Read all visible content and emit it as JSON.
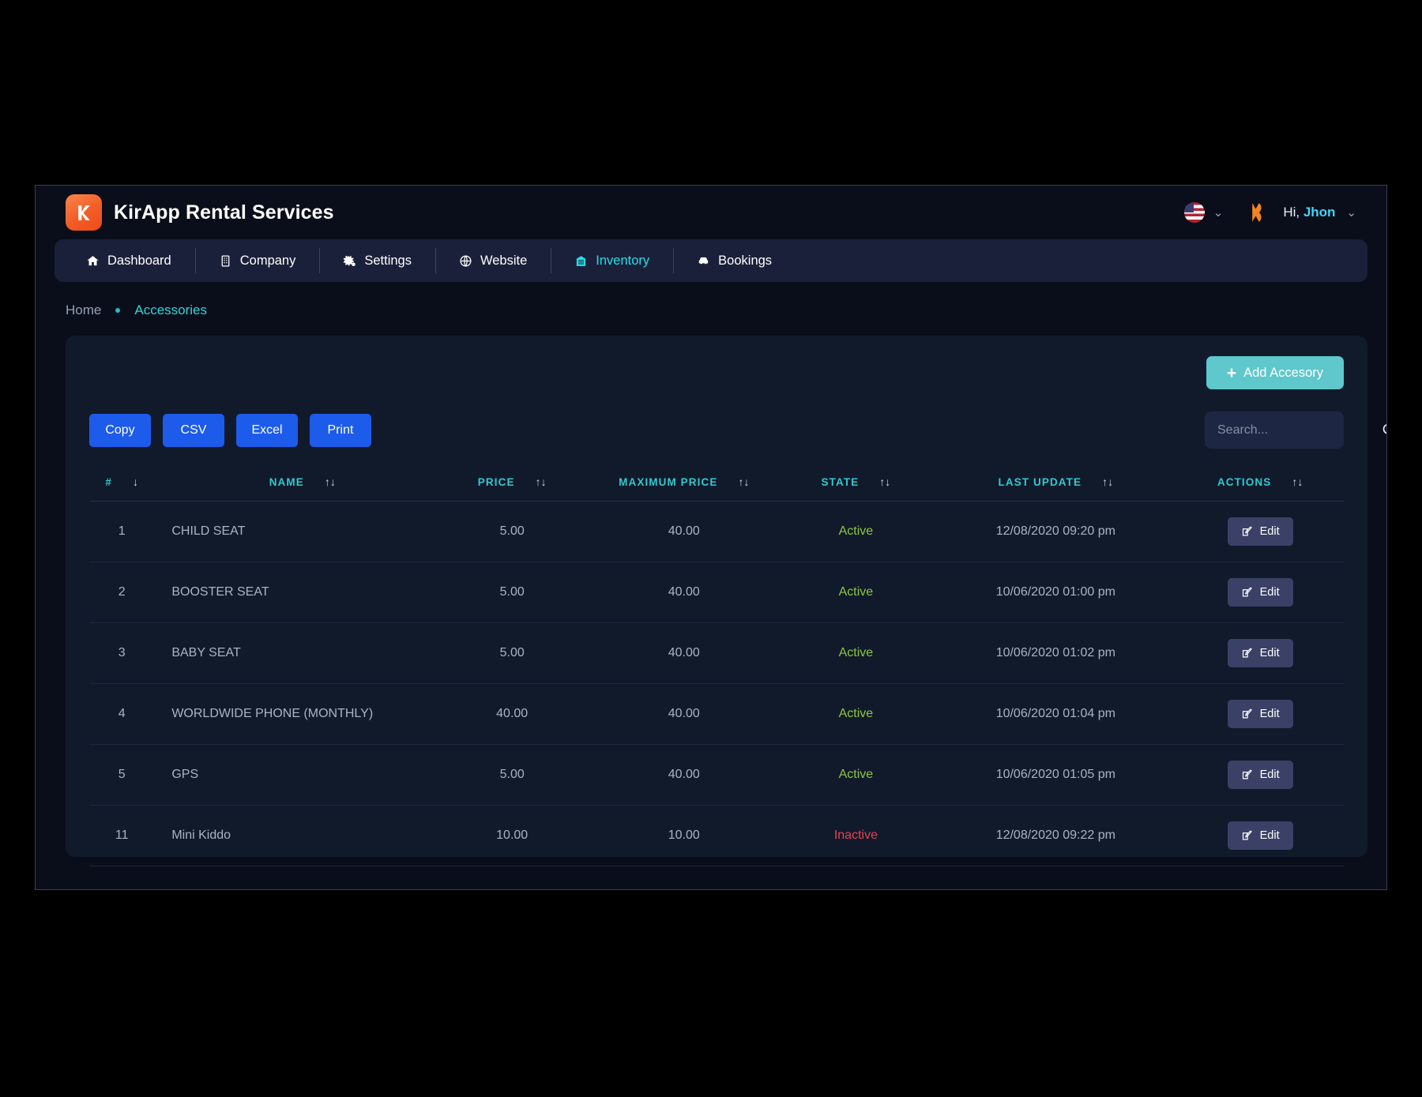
{
  "header": {
    "brand_title": "KirApp Rental Services",
    "logo_icon": "k-logo-icon",
    "flag_icon": "us-flag-icon",
    "lang_chevron": "⌄",
    "avatar_icon": "k-avatar-icon",
    "greet_prefix": "Hi, ",
    "greet_name": "Jhon",
    "user_chevron": "⌄"
  },
  "nav": {
    "items": [
      {
        "label": "Dashboard",
        "icon": "home-icon",
        "active": false
      },
      {
        "label": "Company",
        "icon": "building-icon",
        "active": false
      },
      {
        "label": "Settings",
        "icon": "gears-icon",
        "active": false
      },
      {
        "label": "Website",
        "icon": "globe-icon",
        "active": false
      },
      {
        "label": "Inventory",
        "icon": "inventory-icon",
        "active": true
      },
      {
        "label": "Bookings",
        "icon": "car-icon",
        "active": false
      }
    ]
  },
  "breadcrumb": {
    "home": "Home",
    "current": "Accessories"
  },
  "toolbar": {
    "add_label": "Add Accesory",
    "add_plus": "+",
    "export_buttons": [
      "Copy",
      "CSV",
      "Excel",
      "Print"
    ],
    "search_placeholder": "Search...",
    "search_value": "",
    "search_icon": "search-icon"
  },
  "table": {
    "columns": [
      {
        "label": "#",
        "sort": "↓"
      },
      {
        "label": "NAME",
        "sort": "↑↓"
      },
      {
        "label": "PRICE",
        "sort": "↑↓"
      },
      {
        "label": "MAXIMUM PRICE",
        "sort": "↑↓"
      },
      {
        "label": "STATE",
        "sort": "↑↓"
      },
      {
        "label": "LAST UPDATE",
        "sort": "↑↓"
      },
      {
        "label": "ACTIONS",
        "sort": "↑↓"
      }
    ],
    "action_label": "Edit",
    "action_icon": "edit-pencil-icon",
    "rows": [
      {
        "idx": "1",
        "name": "CHILD SEAT",
        "price": "5.00",
        "max_price": "40.00",
        "state": "Active",
        "state_kind": "active",
        "last_update": "12/08/2020 09:20 pm"
      },
      {
        "idx": "2",
        "name": "BOOSTER SEAT",
        "price": "5.00",
        "max_price": "40.00",
        "state": "Active",
        "state_kind": "active",
        "last_update": "10/06/2020 01:00 pm"
      },
      {
        "idx": "3",
        "name": "BABY SEAT",
        "price": "5.00",
        "max_price": "40.00",
        "state": "Active",
        "state_kind": "active",
        "last_update": "10/06/2020 01:02 pm"
      },
      {
        "idx": "4",
        "name": "WORLDWIDE PHONE (MONTHLY)",
        "price": "40.00",
        "max_price": "40.00",
        "state": "Active",
        "state_kind": "active",
        "last_update": "10/06/2020 01:04 pm"
      },
      {
        "idx": "5",
        "name": "GPS",
        "price": "5.00",
        "max_price": "40.00",
        "state": "Active",
        "state_kind": "active",
        "last_update": "10/06/2020 01:05 pm"
      },
      {
        "idx": "11",
        "name": "Mini Kiddo",
        "price": "10.00",
        "max_price": "10.00",
        "state": "Inactive",
        "state_kind": "inactive",
        "last_update": "12/08/2020 09:22 pm"
      }
    ]
  },
  "colors": {
    "accent_teal": "#2fd5d8",
    "brand_orange": "#f25c27",
    "button_blue": "#1d5beb",
    "add_button": "#5ec8cc",
    "state_active": "#8dc63f",
    "state_inactive": "#e8404f"
  }
}
